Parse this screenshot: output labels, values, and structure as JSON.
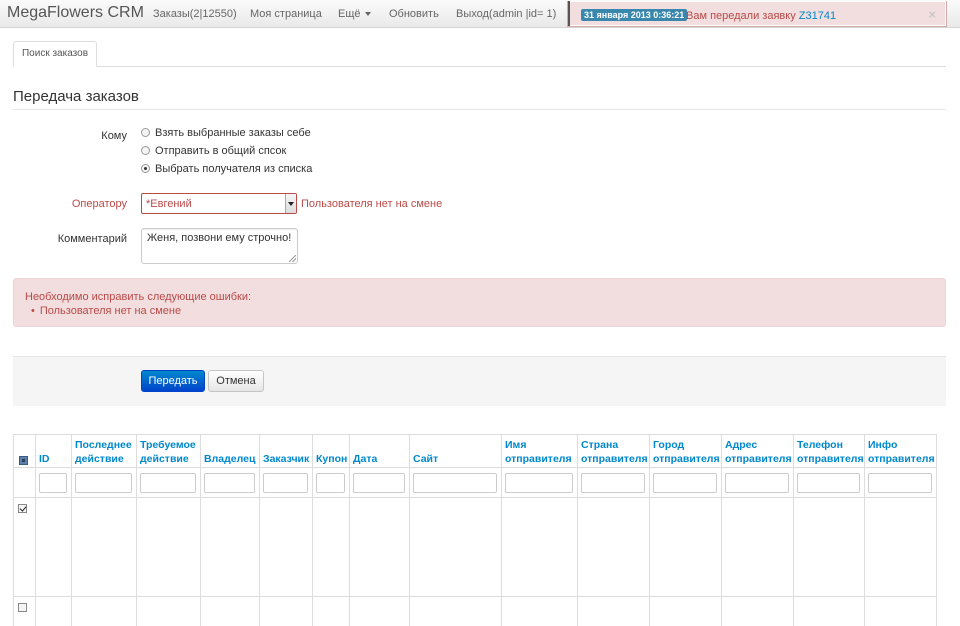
{
  "navbar": {
    "brand": "MegaFlowers CRM",
    "items": [
      {
        "label": "Заказы(2|12550)"
      },
      {
        "label": "Моя страница"
      },
      {
        "label": "Ещё"
      },
      {
        "label": "Обновить"
      },
      {
        "label": "Выход(admin |id= 1)"
      }
    ]
  },
  "notification": {
    "date": "31 января 2013 0:36:21",
    "text": "Вам передали заявку",
    "link": "Z31741",
    "close": "×"
  },
  "tabs": [
    {
      "label": "Поиск заказов"
    }
  ],
  "page": {
    "title": "Передача заказов"
  },
  "form": {
    "to_label": "Кому",
    "radios": [
      {
        "label": "Взять выбранные заказы себе",
        "checked": false
      },
      {
        "label": "Отправить в общий спсок",
        "checked": false
      },
      {
        "label": "Выбрать получателя из списка",
        "checked": true
      }
    ],
    "operator_label": "Оператору",
    "operator_value": "*Евгений",
    "operator_error": "Пользователя нет на смене",
    "comment_label": "Комментарий",
    "comment_value": "Женя, позвони ему строчно!"
  },
  "alert": {
    "title": "Необходимо исправить следующие ошибки:",
    "items": [
      "Пользователя нет на смене"
    ]
  },
  "actions": {
    "submit": "Передать",
    "cancel": "Отмена"
  },
  "table": {
    "columns": [
      {
        "l1": "ID",
        "l2": ""
      },
      {
        "l1": "Последнее",
        "l2": "действие"
      },
      {
        "l1": "Требуемое",
        "l2": "действие"
      },
      {
        "l1": "Владелец",
        "l2": ""
      },
      {
        "l1": "Заказчик",
        "l2": ""
      },
      {
        "l1": "Купон",
        "l2": ""
      },
      {
        "l1": "Дата",
        "l2": ""
      },
      {
        "l1": "Сайт",
        "l2": ""
      },
      {
        "l1": "Имя",
        "l2": "отправителя"
      },
      {
        "l1": "Страна",
        "l2": "отправителя"
      },
      {
        "l1": "Город",
        "l2": "отправителя"
      },
      {
        "l1": "Адрес",
        "l2": "отправителя"
      },
      {
        "l1": "Телефон",
        "l2": "отправителя"
      },
      {
        "l1": "Инфо",
        "l2": "отправителя"
      }
    ],
    "rows": [
      {
        "checked": true
      },
      {
        "checked": false
      }
    ]
  }
}
